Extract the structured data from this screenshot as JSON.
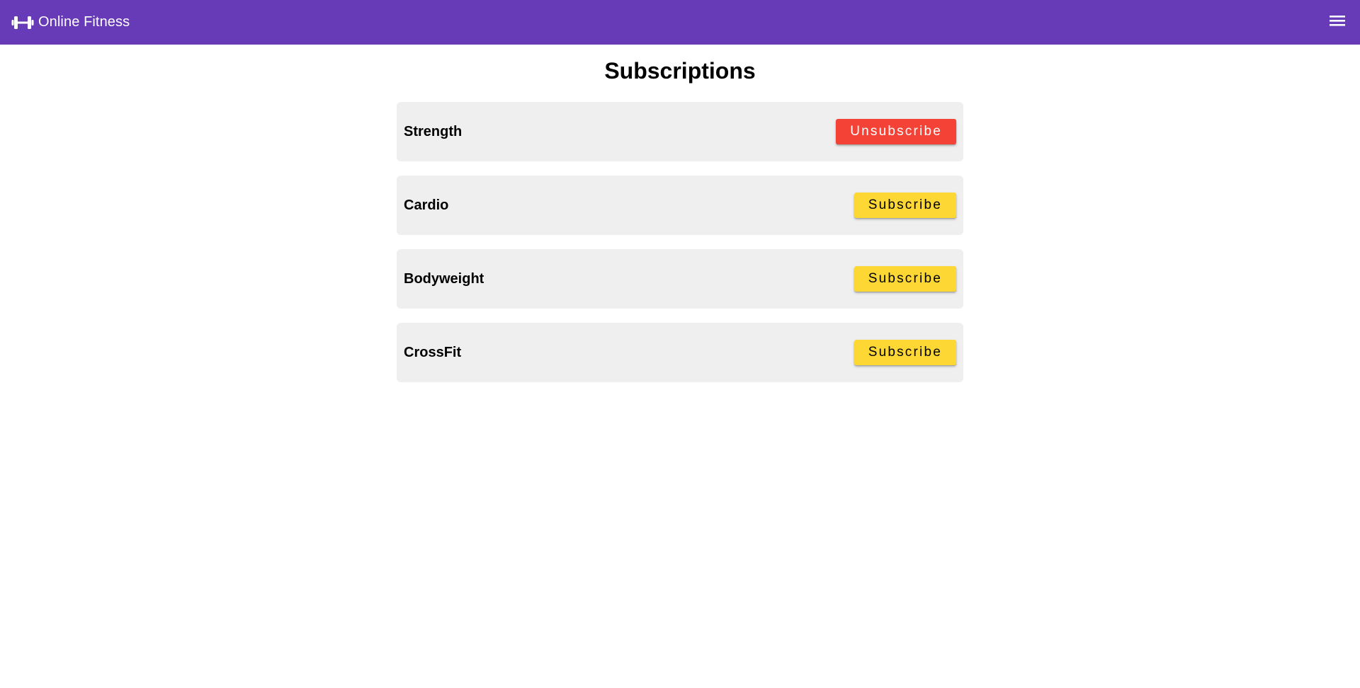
{
  "header": {
    "brand_icon": "dumbbell-icon",
    "brand": "Online Fitness",
    "menu_icon": "hamburger-menu-icon",
    "background_color": "#673ab7"
  },
  "main": {
    "title": "Subscriptions",
    "subscriptions": [
      {
        "name": "Strength",
        "action": "Unsubscribe",
        "state": "subscribed",
        "button_color": "#f44336"
      },
      {
        "name": "Cardio",
        "action": "Subscribe",
        "state": "not-subscribed",
        "button_color": "#fdd835"
      },
      {
        "name": "Bodyweight",
        "action": "Subscribe",
        "state": "not-subscribed",
        "button_color": "#fdd835"
      },
      {
        "name": "CrossFit",
        "action": "Subscribe",
        "state": "not-subscribed",
        "button_color": "#fdd835"
      }
    ]
  }
}
